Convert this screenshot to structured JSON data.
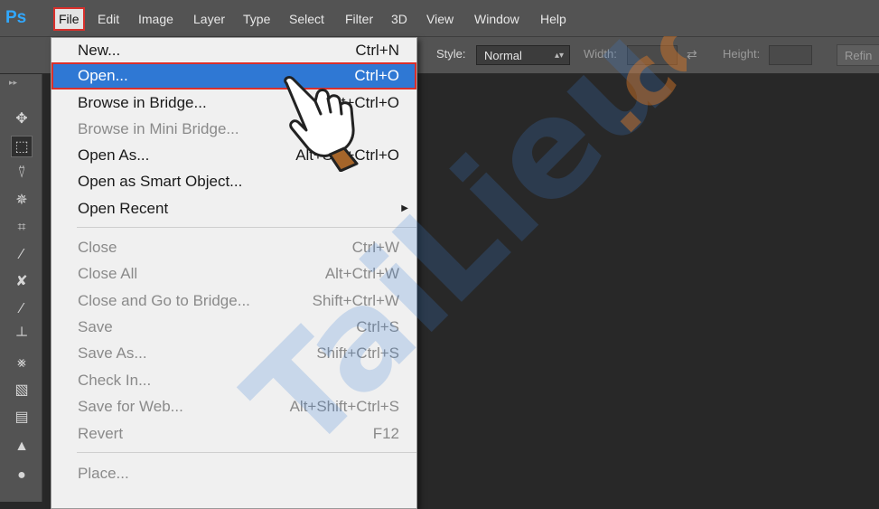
{
  "app": {
    "logo": "Ps"
  },
  "menubar": {
    "items": [
      "File",
      "Edit",
      "Image",
      "Layer",
      "Type",
      "Select",
      "Filter",
      "3D",
      "View",
      "Window",
      "Help"
    ],
    "active": "File"
  },
  "options_bar": {
    "style_label": "Style:",
    "style_value": "Normal",
    "width_label": "Width:",
    "height_label": "Height:",
    "refine_label": "Refin"
  },
  "file_menu": {
    "items": [
      {
        "label": "New...",
        "shortcut": "Ctrl+N",
        "enabled": true
      },
      {
        "label": "Open...",
        "shortcut": "Ctrl+O",
        "enabled": true,
        "highlighted": true
      },
      {
        "label": "Browse in Bridge...",
        "shortcut": "t+Ctrl+O",
        "enabled": true
      },
      {
        "label": "Browse in Mini Bridge...",
        "shortcut": "",
        "enabled": false
      },
      {
        "label": "Open As...",
        "shortcut": "Alt+Sh  +Ctrl+O",
        "enabled": true
      },
      {
        "label": "Open as Smart Object...",
        "shortcut": "",
        "enabled": true
      },
      {
        "label": "Open Recent",
        "shortcut": "",
        "enabled": true,
        "submenu": true
      },
      {
        "label": "Close",
        "shortcut": "Ctrl+W",
        "enabled": false
      },
      {
        "label": "Close All",
        "shortcut": "Alt+Ctrl+W",
        "enabled": false
      },
      {
        "label": "Close and Go to Bridge...",
        "shortcut": "Shift+Ctrl+W",
        "enabled": false
      },
      {
        "label": "Save",
        "shortcut": "Ctrl+S",
        "enabled": false
      },
      {
        "label": "Save As...",
        "shortcut": "Shift+Ctrl+S",
        "enabled": false
      },
      {
        "label": "Check In...",
        "shortcut": "",
        "enabled": false
      },
      {
        "label": "Save for Web...",
        "shortcut": "Alt+Shift+Ctrl+S",
        "enabled": false
      },
      {
        "label": "Revert",
        "shortcut": "F12",
        "enabled": false
      },
      {
        "label": "Place...",
        "shortcut": "",
        "enabled": false
      }
    ]
  },
  "toolbar": {
    "tools": [
      "move-tool",
      "marquee-tool",
      "lasso-tool",
      "magic-wand-tool",
      "crop-tool",
      "eyedropper-tool",
      "healing-brush-tool",
      "brush-tool",
      "clone-stamp-tool",
      "history-brush-tool",
      "eraser-tool",
      "gradient-tool",
      "blur-tool",
      "dodge-tool"
    ]
  },
  "watermark": {
    "text": "TaiLieu.com"
  },
  "colors": {
    "highlight": "#2f78d4",
    "annotation_red": "#d9302c",
    "chrome": "#535353",
    "canvas": "#282828",
    "menu_bg": "#f0f0f0"
  }
}
